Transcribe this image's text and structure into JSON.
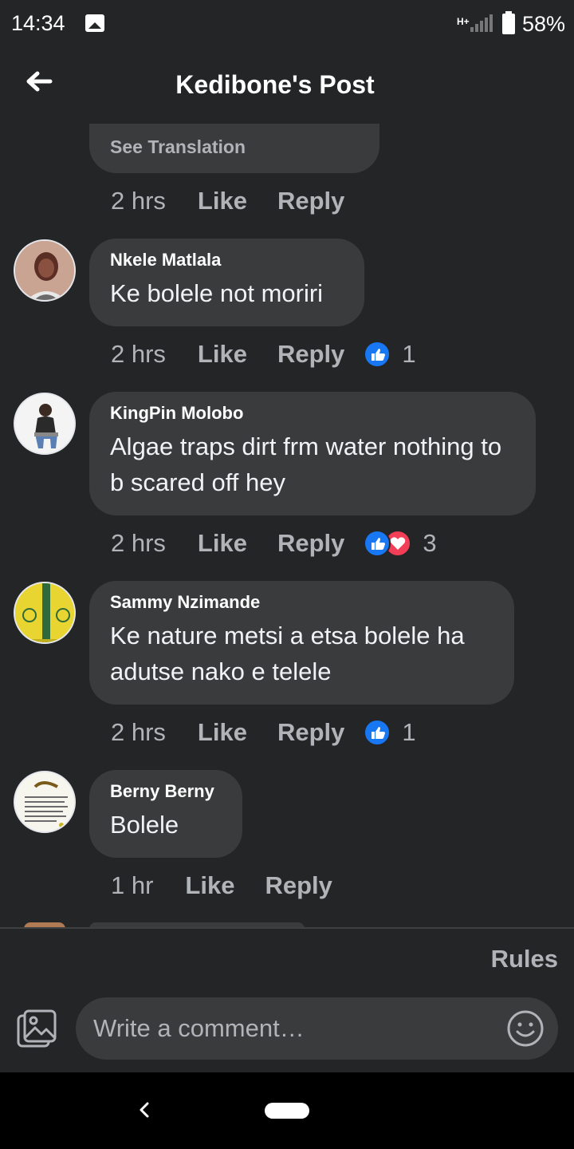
{
  "status_bar": {
    "time": "14:34",
    "network": "H+",
    "battery": "58%"
  },
  "header": {
    "title": "Kedibone's Post"
  },
  "top_comment": {
    "see_translation": "See Translation",
    "time": "2 hrs",
    "like": "Like",
    "reply": "Reply"
  },
  "comments": [
    {
      "author": "Nkele Matlala",
      "text": "Ke bolele not moriri",
      "time": "2 hrs",
      "like": "Like",
      "reply": "Reply",
      "reactions": [
        "like"
      ],
      "reaction_count": "1"
    },
    {
      "author": "KingPin Molobo",
      "text": "Algae traps dirt frm water nothing to b scared off  hey",
      "time": "2 hrs",
      "like": "Like",
      "reply": "Reply",
      "reactions": [
        "like",
        "love"
      ],
      "reaction_count": "3"
    },
    {
      "author": "Sammy Nzimande",
      "text": "Ke nature metsi a etsa bolele ha adutse nako e telele",
      "time": "2 hrs",
      "like": "Like",
      "reply": "Reply",
      "reactions": [
        "like"
      ],
      "reaction_count": "1"
    },
    {
      "author": "Berny Berny",
      "text": "Bolele",
      "time": "1 hr",
      "like": "Like",
      "reply": "Reply",
      "reactions": [],
      "reaction_count": ""
    }
  ],
  "footer": {
    "rules": "Rules",
    "comment_placeholder": "Write a comment…"
  },
  "colors": {
    "background": "#242526",
    "bubble": "#3a3b3c",
    "like_blue": "#1877f2",
    "love_red": "#f33e58",
    "muted_text": "#b0b3b8"
  }
}
